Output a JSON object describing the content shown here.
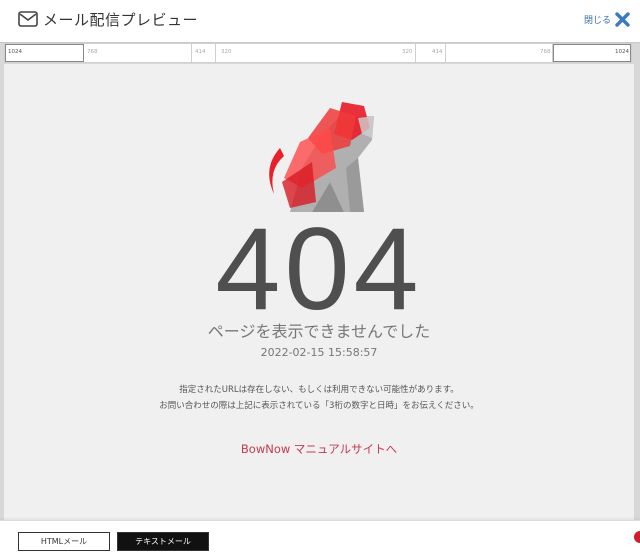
{
  "header": {
    "title": "メール配信プレビュー",
    "close_label": "閉じる",
    "mail_icon": "mail-icon",
    "close_icon": "close-x-icon"
  },
  "ruler": {
    "labels": [
      "1024",
      "768",
      "414",
      "320",
      "320",
      "414",
      "768",
      "1024"
    ]
  },
  "content": {
    "error_code": "404",
    "message": "ページを表示できませんでした",
    "timestamp": "2022-02-15 15:58:57",
    "note_line1": "指定されたURLは存在しない、もしくは利用できない可能性があります。",
    "note_line2": "お問い合わせの際は上記に表示されている「3桁の数字と日時」をお伝えください。",
    "manual_link": "BowNow マニュアルサイトへ",
    "illustration": "dog-illustration"
  },
  "footer": {
    "html_tab": "HTMLメール",
    "text_tab": "テキストメール"
  },
  "colors": {
    "accent_red": "#e8202a",
    "link": "#c33a4e",
    "close_blue": "#3a6fa5"
  }
}
